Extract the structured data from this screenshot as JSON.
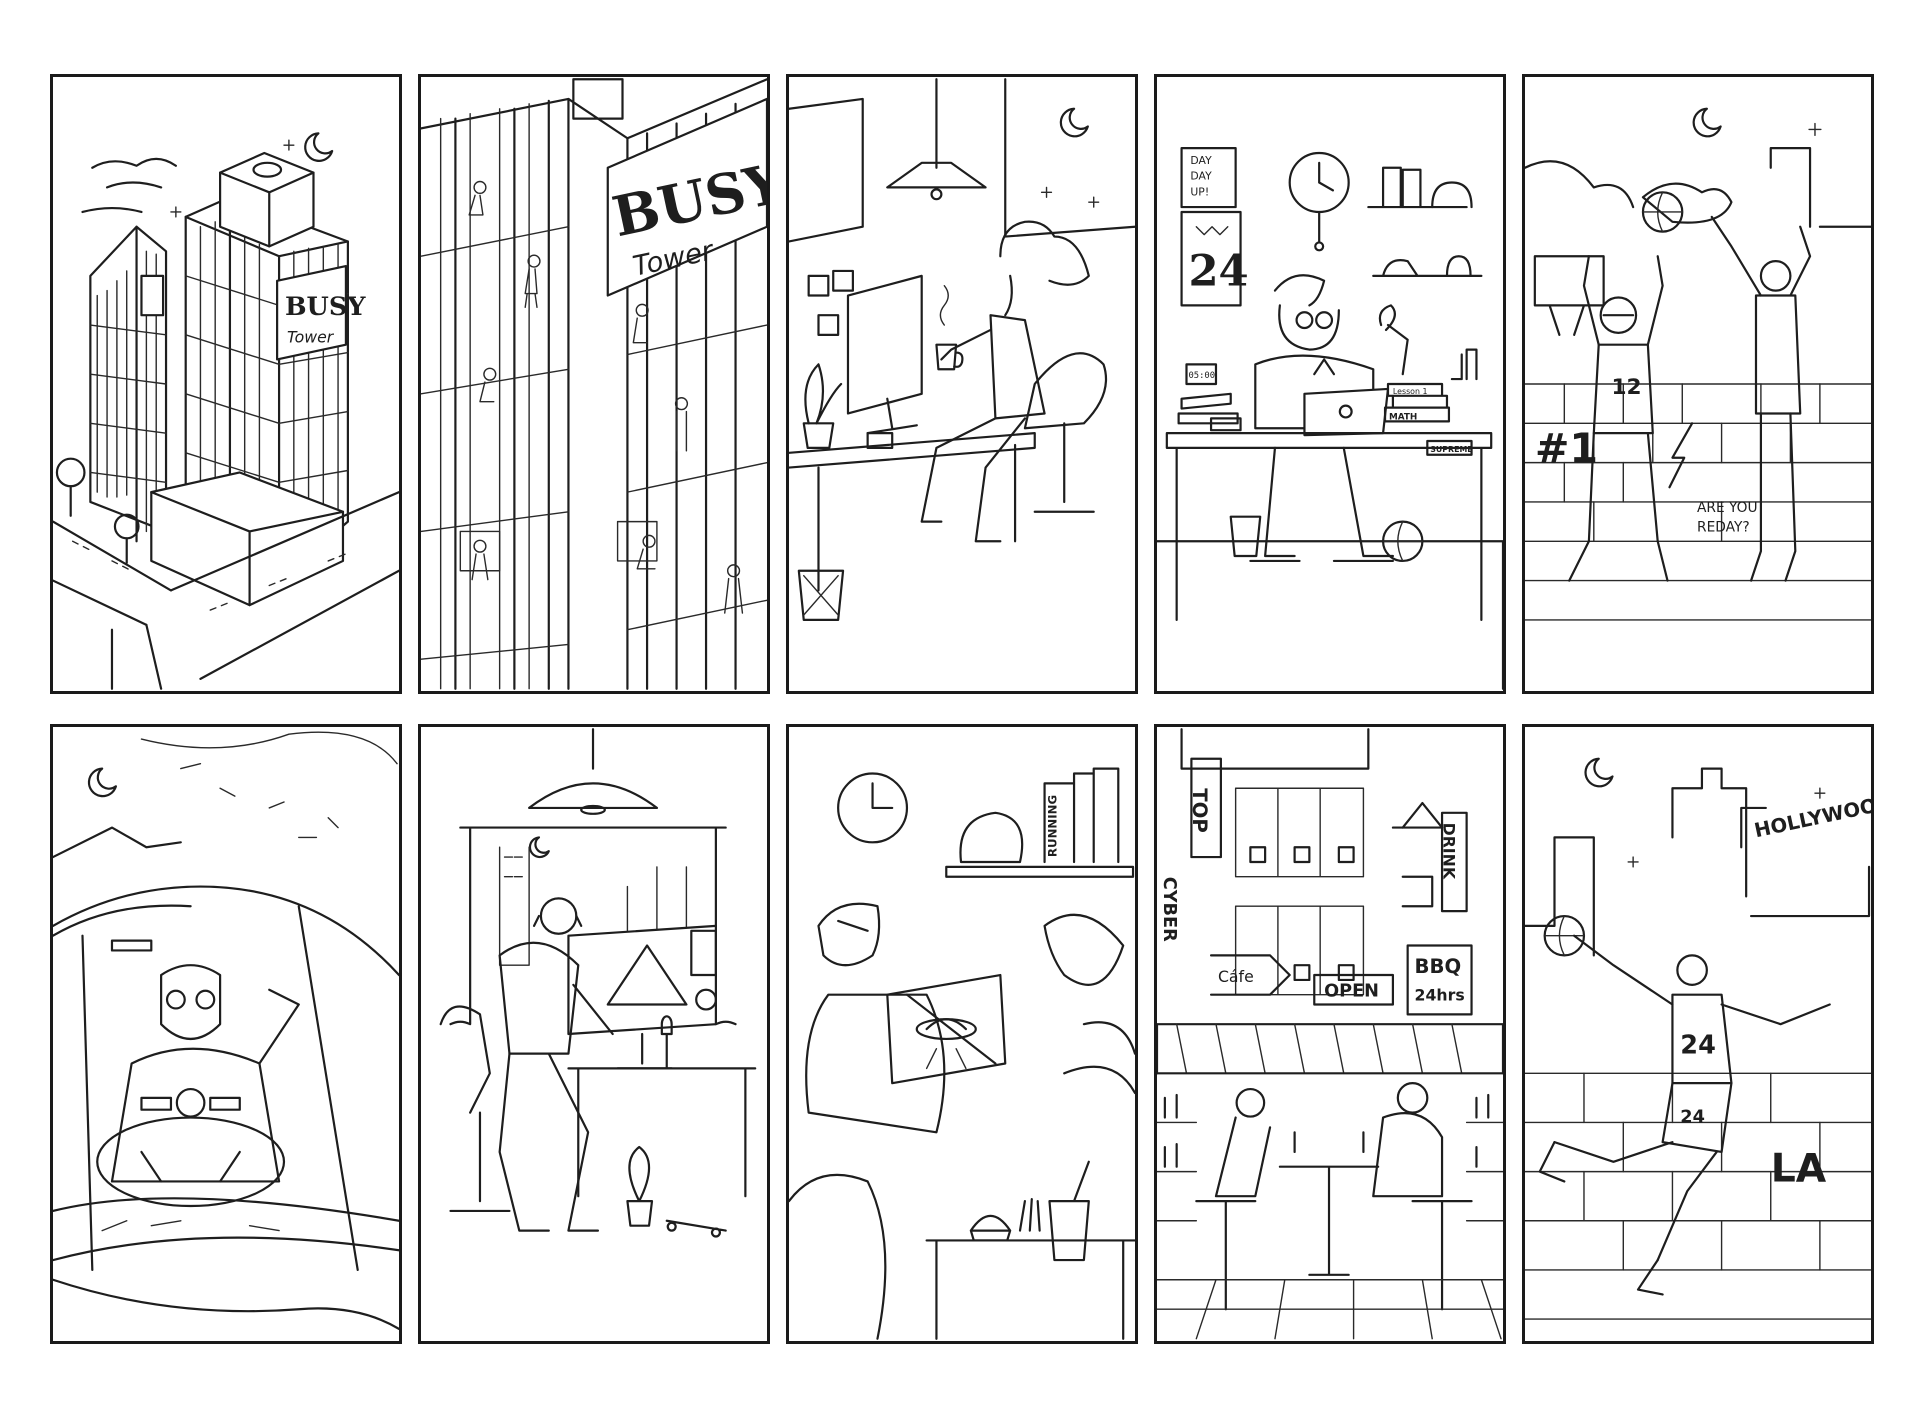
{
  "panels": [
    {
      "id": "p1",
      "scene": "busy-tower-exterior",
      "sign": {
        "line1": "BUSY",
        "line2": "Tower"
      }
    },
    {
      "id": "p2",
      "scene": "busy-tower-closeup",
      "sign": {
        "line1": "BUSY",
        "line2": "Tower"
      }
    },
    {
      "id": "p3",
      "scene": "woman-at-computer"
    },
    {
      "id": "p4",
      "scene": "student-at-desk",
      "poster": {
        "line1": "DAY",
        "line2": "DAY",
        "line3": "UP!"
      },
      "jersey_frame": "24",
      "books": {
        "math": "MATH",
        "lesson": "Lesson 1"
      },
      "sticker": "SUPREME",
      "clock_display": "05:00"
    },
    {
      "id": "p5",
      "scene": "basketball-court",
      "wall": {
        "tag": "#1",
        "question_line1": "ARE YOU",
        "question_line2": "REDAY?"
      },
      "jersey": "12"
    },
    {
      "id": "p6",
      "scene": "driver-in-car"
    },
    {
      "id": "p7",
      "scene": "designer-at-monitor"
    },
    {
      "id": "p8",
      "scene": "gamer-with-tablet",
      "book_spine": "RUNNING"
    },
    {
      "id": "p9",
      "scene": "street-cafe",
      "signs": {
        "top": "TOP",
        "cyber": "CYBER",
        "cafe": "Cáfe",
        "drink": "DRINK",
        "open": "OPEN",
        "bbq": "BBQ",
        "hours": "24hrs"
      }
    },
    {
      "id": "p10",
      "scene": "los-angeles-dunk",
      "hollywood": "HOLLYWOOD",
      "jersey": "24",
      "shorts": "24",
      "la": "LA"
    }
  ]
}
